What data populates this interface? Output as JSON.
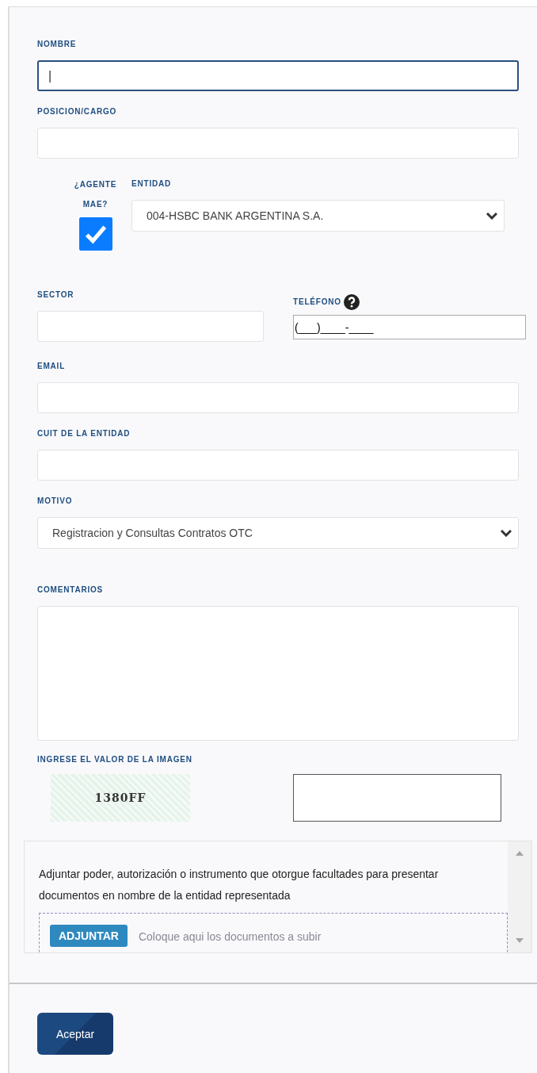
{
  "fields": [
    {
      "label": "NOMBRE",
      "value": "|",
      "focused": true
    },
    {
      "label": "POSICION/CARGO",
      "focused": false
    }
  ],
  "agente": {
    "label": "¿AGENTE MAE?",
    "checked": true
  },
  "entidad": {
    "label": "ENTIDAD",
    "value": "004-HSBC BANK ARGENTINA S.A."
  },
  "sector": {
    "label": "SECTOR"
  },
  "telefono": {
    "label": "TELÉFONO",
    "value": "(___)____-____"
  },
  "fields2": [
    {
      "kind": "text",
      "label": "EMAIL"
    },
    {
      "kind": "text",
      "label": "CUIT DE LA ENTIDAD"
    },
    {
      "kind": "select",
      "label": "MOTIVO",
      "value": "Registracion y Consultas Contratos OTC"
    },
    {
      "kind": "textarea",
      "label": "COMENTARIOS"
    }
  ],
  "captcha": {
    "label": "INGRESE EL VALOR DE LA IMAGEN",
    "code": "1380FF"
  },
  "attach": {
    "text": "Adjuntar poder, autorización o instrumento que otorgue facultades para presentar documentos en nombre de la entidad representada",
    "button": "ADJUNTAR",
    "placeholder": "Coloque aqui los documentos a subir"
  },
  "submit": "Aceptar"
}
